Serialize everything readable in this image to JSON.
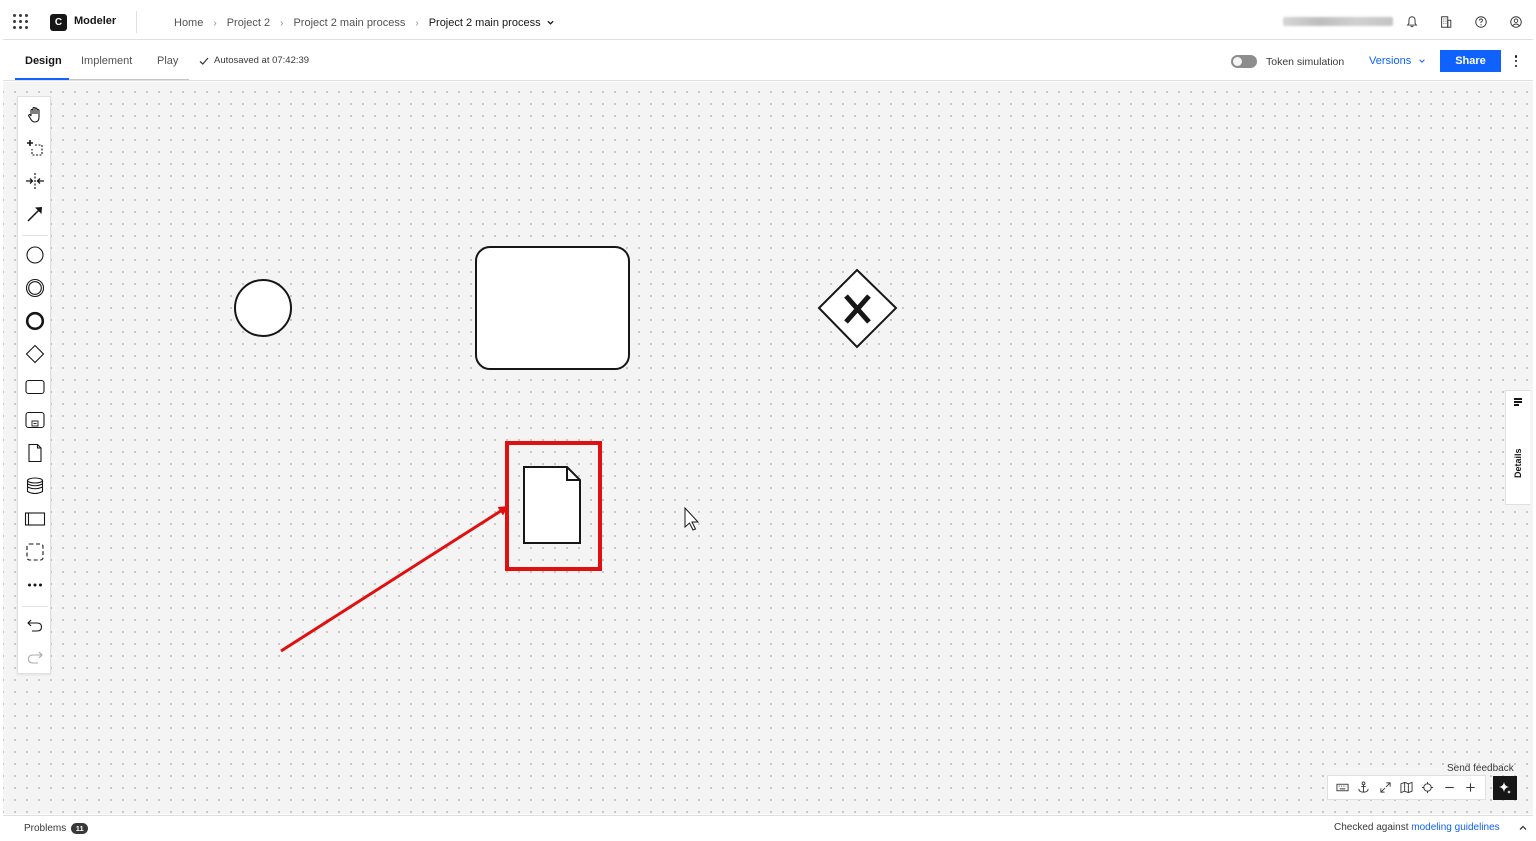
{
  "app": {
    "product": "Modeler",
    "logo_letter": "C"
  },
  "breadcrumbs": {
    "home": "Home",
    "project": "Project 2",
    "process": "Project 2 main process",
    "current": "Project 2 main process"
  },
  "tabs": [
    {
      "label": "Design",
      "active": true
    },
    {
      "label": "Implement",
      "active": false
    },
    {
      "label": "Play",
      "active": false
    }
  ],
  "autosave": "Autosaved at 07:42:39",
  "toolbar": {
    "token_simulation_label": "Token simulation",
    "token_simulation_on": false,
    "versions_label": "Versions",
    "share_label": "Share"
  },
  "palette_tools": [
    "hand-tool-icon",
    "lasso-tool-icon",
    "space-tool-icon",
    "connect-tool-icon",
    "start-event-icon",
    "intermediate-event-icon",
    "end-event-icon",
    "gateway-icon",
    "task-icon",
    "subprocess-icon",
    "data-object-icon",
    "data-store-icon",
    "pool-icon",
    "group-icon",
    "more-icon",
    "undo-icon",
    "redo-icon"
  ],
  "details_panel": {
    "label": "Details"
  },
  "canvas_controls": {
    "send_feedback": "Send feedback",
    "buttons": [
      "keyboard-icon",
      "anchor-icon",
      "fullscreen-icon",
      "minimap-icon",
      "center-icon",
      "zoom-out-icon",
      "zoom-in-icon"
    ]
  },
  "bottom": {
    "problems_label": "Problems",
    "problems_count": "11",
    "checked_prefix": "Checked against",
    "checked_link": "modeling guidelines"
  },
  "colors": {
    "accent": "#0f62fe",
    "highlight": "#e00000",
    "canvas_bg": "#f4f4f4"
  }
}
